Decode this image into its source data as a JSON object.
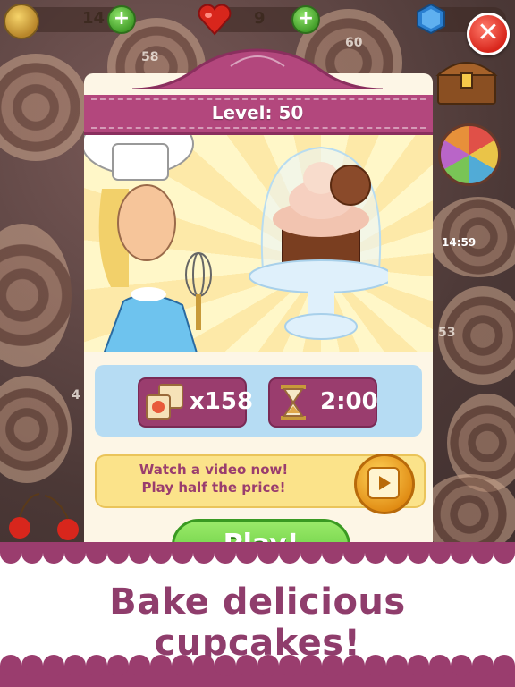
{
  "hud": {
    "coins": "14",
    "lives": "9",
    "plus_label": "+",
    "close_label": "✕"
  },
  "board_numbers": [
    "58",
    "60",
    "53",
    "4",
    "14:59"
  ],
  "dialog": {
    "level_title": "Level: 50",
    "boosters_count": "x158",
    "time_limit": "2:00",
    "offer_line1": "Watch a video now!",
    "offer_line2": "Play half the price!",
    "play_label": "Play!"
  },
  "banner": {
    "text": "Bake delicious cupcakes!"
  },
  "colors": {
    "accent_purple": "#9a3d6e",
    "header_purple": "#b3477d",
    "stats_blue": "#b6dcf3",
    "offer_yellow": "#fbe38a",
    "play_green": "#4fbf2e",
    "close_red": "#d8261c"
  }
}
